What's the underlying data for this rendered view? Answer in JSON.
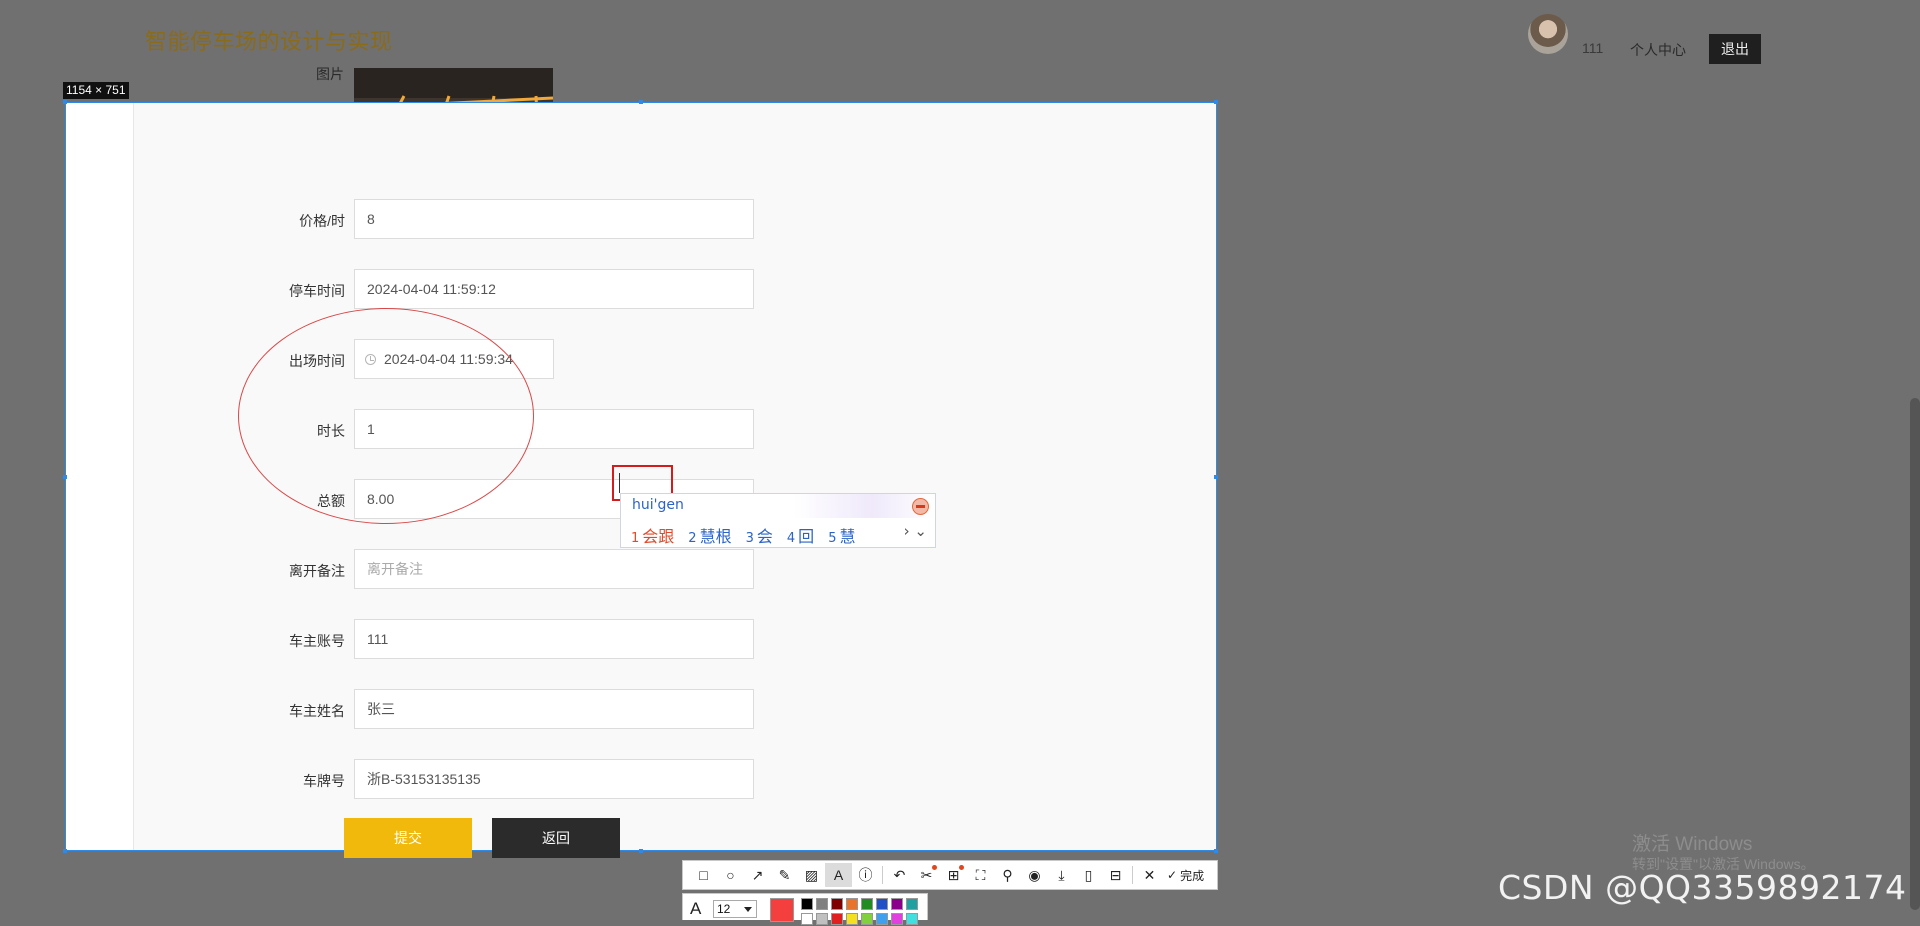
{
  "header": {
    "title": "智能停车场的设计与实现",
    "username": "111",
    "profile_link": "个人中心",
    "logout_label": "退出"
  },
  "capture_size_label": "1154 × 751",
  "form": {
    "image_label": "图片",
    "fields": [
      {
        "label": "价格/时",
        "value": "8",
        "placeholder": ""
      },
      {
        "label": "停车时间",
        "value": "2024-04-04 11:59:12",
        "placeholder": ""
      },
      {
        "label": "出场时间",
        "value": "2024-04-04 11:59:34",
        "placeholder": ""
      },
      {
        "label": "时长",
        "value": "1",
        "placeholder": ""
      },
      {
        "label": "总额",
        "value": "8.00",
        "placeholder": ""
      },
      {
        "label": "离开备注",
        "value": "",
        "placeholder": "离开备注"
      },
      {
        "label": "车主账号",
        "value": "111",
        "placeholder": ""
      },
      {
        "label": "车主姓名",
        "value": "张三",
        "placeholder": ""
      },
      {
        "label": "车牌号",
        "value": "浙B-53153135135",
        "placeholder": ""
      }
    ],
    "submit_label": "提交",
    "back_label": "返回"
  },
  "ime": {
    "pinyin": "hui'gen",
    "candidates": [
      {
        "num": "1",
        "text": "会跟"
      },
      {
        "num": "2",
        "text": "慧根"
      },
      {
        "num": "3",
        "text": "会"
      },
      {
        "num": "4",
        "text": "回"
      },
      {
        "num": "5",
        "text": "慧"
      }
    ],
    "more": "› ⌄"
  },
  "toolbar": {
    "done_label": "完成",
    "font_size": "12",
    "selected_color": "#f43f3f",
    "palette": [
      "#000000",
      "#808080",
      "#800000",
      "#e8732a",
      "#228b22",
      "#2050c8",
      "#8b008b",
      "#20a0a0",
      "#ffffff",
      "#c0c0c0",
      "#e02020",
      "#f5e020",
      "#80d040",
      "#40a0f0",
      "#e040e0",
      "#40e0e0"
    ]
  },
  "watermark": {
    "line1": "激活 Windows",
    "line2": "转到\"设置\"以激活 Windows。",
    "csdn": "CSDN @QQ3359892174"
  }
}
